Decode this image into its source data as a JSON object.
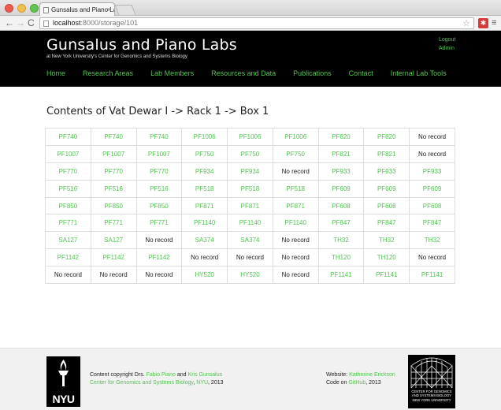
{
  "browser": {
    "tab_title": "Gunsalus and Piano Labs",
    "tab_close": "×",
    "url_host": "localhost",
    "url_path": ":8000/storage/101",
    "back_glyph": "←",
    "forward_glyph": "→",
    "reload_glyph": "C",
    "star_glyph": "☆",
    "menu_glyph": "≡",
    "ext_glyph": "✱"
  },
  "header": {
    "title": "Gunsalus and Piano Labs",
    "subtitle": "at New York University's Center for Genomics and Systems Biology",
    "logout": "Logout",
    "admin": "Admin"
  },
  "nav": {
    "items": [
      "Home",
      "Research Areas",
      "Lab Members",
      "Resources and Data",
      "Publications",
      "Contact",
      "Internal Lab Tools"
    ]
  },
  "main": {
    "heading": "Contents of Vat Dewar I -> Rack 1 -> Box 1",
    "rows": [
      [
        "PF740",
        "PF740",
        "PF740",
        "PF1006",
        "PF1006",
        "PF1006",
        "PF820",
        "PF820",
        "No record"
      ],
      [
        "PF1007",
        "PF1007",
        "PF1007",
        "PF750",
        "PF750",
        "PF750",
        "PF821",
        "PF821",
        "No record"
      ],
      [
        "PF770",
        "PF770",
        "PF770",
        "PF934",
        "PF934",
        "No record",
        "PF933",
        "PF933",
        "PF933"
      ],
      [
        "PF516",
        "PF516",
        "PF516",
        "PF518",
        "PF518",
        "PF518",
        "PF609",
        "PF609",
        "PF609"
      ],
      [
        "PF850",
        "PF850",
        "PF850",
        "PF871",
        "PF871",
        "PF871",
        "PF608",
        "PF608",
        "PF608"
      ],
      [
        "PF771",
        "PF771",
        "PF771",
        "PF1140",
        "PF1140",
        "PF1140",
        "PF847",
        "PF847",
        "PF847"
      ],
      [
        "SA127",
        "SA127",
        "No record",
        "SA374",
        "SA374",
        "No record",
        "TH32",
        "TH32",
        "TH32"
      ],
      [
        "PF1142",
        "PF1142",
        "PF1142",
        "No record",
        "No record",
        "No record",
        "TH120",
        "TH120",
        "No record"
      ],
      [
        "No record",
        "No record",
        "No record",
        "HY520",
        "HY520",
        "No record",
        "PF1141",
        "PF1141",
        "PF1141"
      ]
    ],
    "empty_label": "No record"
  },
  "footer": {
    "copyright_prefix": "Content copyright Drs. ",
    "piano": "Fabio Piano",
    "and": " and ",
    "gunsalus": "Kris Gunsalus",
    "cgsb": "Center for Genomics and Systems Biology",
    "comma": ", ",
    "nyu": "NYU",
    "year": ", 2013",
    "website_prefix": "Website: ",
    "website_author": "Katherine Erickson",
    "code_prefix": "Code on ",
    "github": "GitHub",
    "code_year": ", 2013",
    "nyu_logo_text": "NYU",
    "cgsb_logo_lines": [
      "CENTER FOR GENOMICS",
      "AND SYSTEMS BIOLOGY",
      "NEW YORK UNIVERSITY"
    ]
  },
  "colors": {
    "accent": "#4fc64f",
    "header_bg": "#000000",
    "footer_bg": "#f1f1f1"
  }
}
